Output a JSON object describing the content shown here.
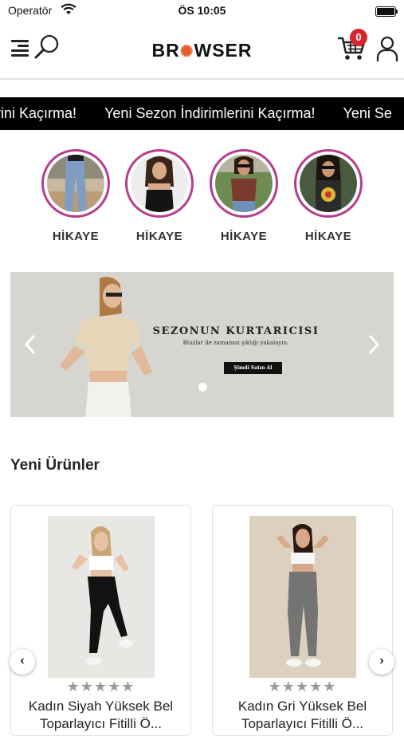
{
  "status_bar": {
    "carrier": "Operatör",
    "time": "ÖS 10:05"
  },
  "header": {
    "logo_left": "BR",
    "logo_right": "WSER",
    "cart_count": "0",
    "brand_color": "#e35b2b",
    "badge_color": "#d7262b"
  },
  "ticker": {
    "items": [
      "erini Kaçırma!",
      "Yeni Sezon İndirimlerini Kaçırma!",
      "Yeni Se"
    ]
  },
  "stories": [
    {
      "label": "HİKAYE",
      "image": "story-jeans"
    },
    {
      "label": "HİKAYE",
      "image": "story-black-top"
    },
    {
      "label": "HİKAYE",
      "image": "story-brown-top"
    },
    {
      "label": "HİKAYE",
      "image": "story-graphic-tee"
    }
  ],
  "banner": {
    "title": "SEZONUN KURTARICISI",
    "subtitle": "Bluzlar ile zamansız şıklığı yakalayın.",
    "cta": "Şimdi Satın Al",
    "slide_index": 1,
    "slide_count": 1
  },
  "new_products": {
    "title": "Yeni Ürünler",
    "items": [
      {
        "name": "Kadın Siyah Yüksek Bel",
        "name_cont": "Toparlayıcı Fitilli Ö...",
        "rating": 0,
        "max_rating": 5
      },
      {
        "name": "Kadın Gri Yüksek Bel",
        "name_cont": "Toparlayıcı Fitilli Ö...",
        "rating": 0,
        "max_rating": 5
      }
    ]
  }
}
